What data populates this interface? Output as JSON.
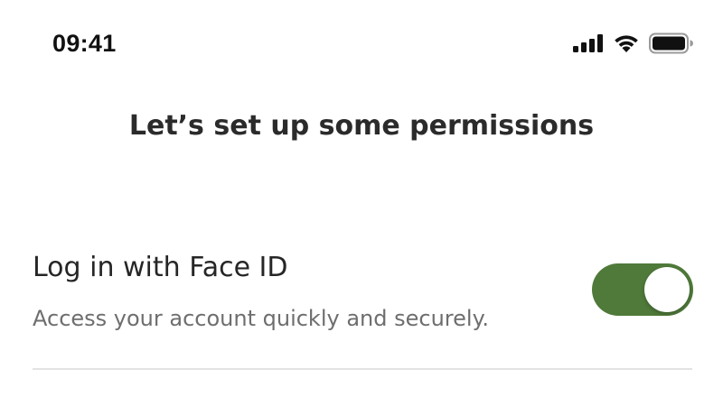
{
  "status_bar": {
    "time": "09:41",
    "icons": [
      "cellular-signal-icon",
      "wifi-icon",
      "battery-icon"
    ]
  },
  "header": {
    "title": "Let’s set up some permissions"
  },
  "permissions": [
    {
      "title": "Log in with Face ID",
      "description": "Access your account quickly and securely.",
      "enabled": true
    }
  ],
  "colors": {
    "toggle_on": "#4f7a3a",
    "title_text": "#2b2b2b",
    "description_text": "#6e6e6e",
    "divider": "#e3e3e3"
  }
}
